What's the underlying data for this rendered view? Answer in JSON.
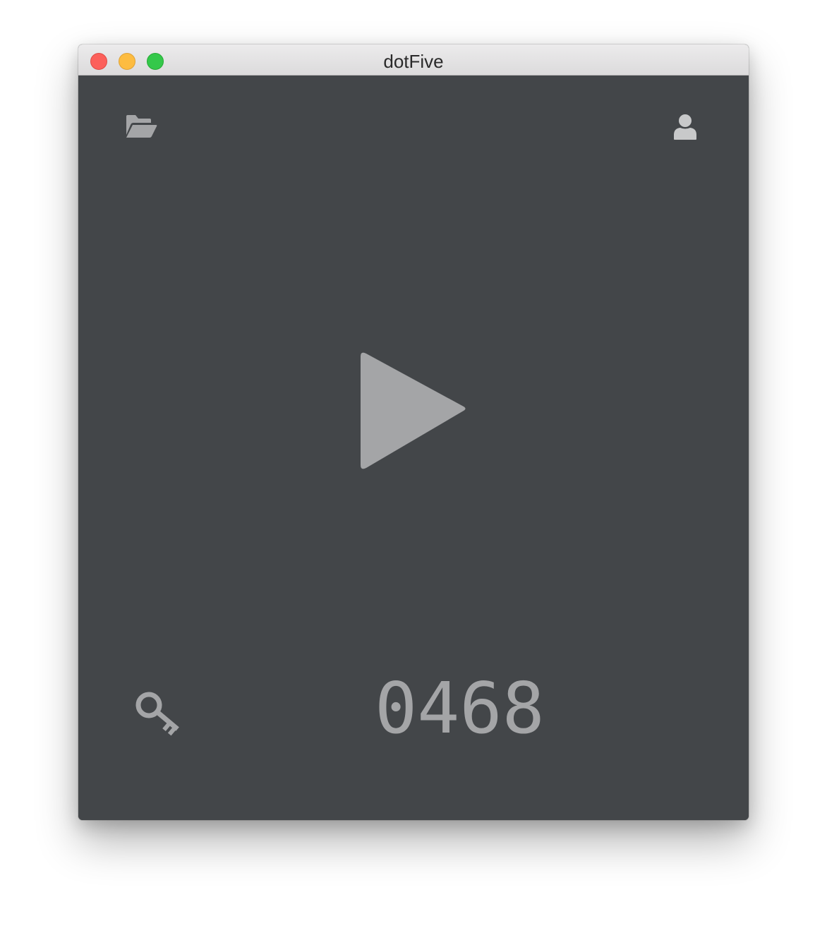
{
  "window": {
    "title": "dotFive"
  },
  "toolbar": {
    "open_icon": "folder-open-icon",
    "account_icon": "user-icon"
  },
  "player": {
    "play_icon": "play-icon"
  },
  "footer": {
    "key_icon": "key-icon",
    "counter": "0468"
  },
  "colors": {
    "background": "#434649",
    "icon": "#a4a5a7",
    "user_icon": "#c8c9ca",
    "traffic_close": "#fc605b",
    "traffic_minimize": "#fdbc40",
    "traffic_zoom": "#34c84a"
  }
}
